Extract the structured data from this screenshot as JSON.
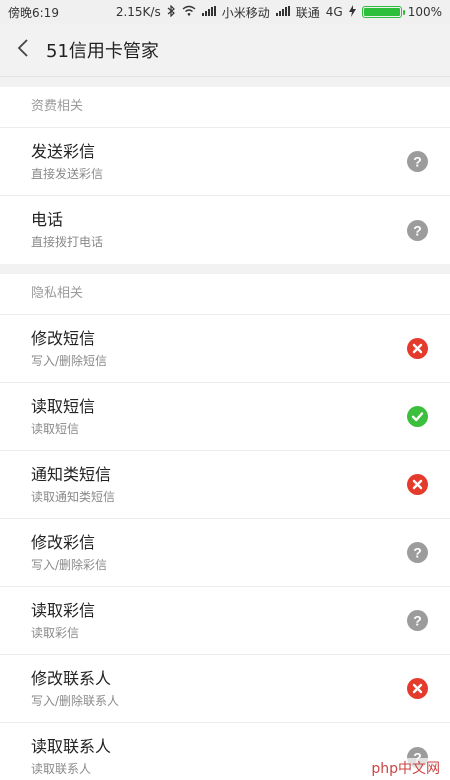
{
  "status_bar": {
    "time": "傍晚6:19",
    "speed": "2.15K/s",
    "carrier1": "小米移动",
    "carrier2": "联通",
    "network": "4G",
    "battery": "100%",
    "battery_level": 1.0
  },
  "header": {
    "title": "51信用卡管家"
  },
  "sections": [
    {
      "title": "资费相关",
      "items": [
        {
          "title": "发送彩信",
          "subtitle": "直接发送彩信",
          "status": "unknown"
        },
        {
          "title": "电话",
          "subtitle": "直接拨打电话",
          "status": "unknown"
        }
      ]
    },
    {
      "title": "隐私相关",
      "items": [
        {
          "title": "修改短信",
          "subtitle": "写入/删除短信",
          "status": "deny"
        },
        {
          "title": "读取短信",
          "subtitle": "读取短信",
          "status": "allow"
        },
        {
          "title": "通知类短信",
          "subtitle": "读取通知类短信",
          "status": "deny"
        },
        {
          "title": "修改彩信",
          "subtitle": "写入/删除彩信",
          "status": "unknown"
        },
        {
          "title": "读取彩信",
          "subtitle": "读取彩信",
          "status": "unknown"
        },
        {
          "title": "修改联系人",
          "subtitle": "写入/删除联系人",
          "status": "deny"
        },
        {
          "title": "读取联系人",
          "subtitle": "读取联系人",
          "status": "unknown"
        }
      ]
    }
  ],
  "watermark": "php中文网",
  "colors": {
    "deny": "#e53b2c",
    "allow": "#3cbf3c",
    "unknown": "#9c9c9c"
  }
}
